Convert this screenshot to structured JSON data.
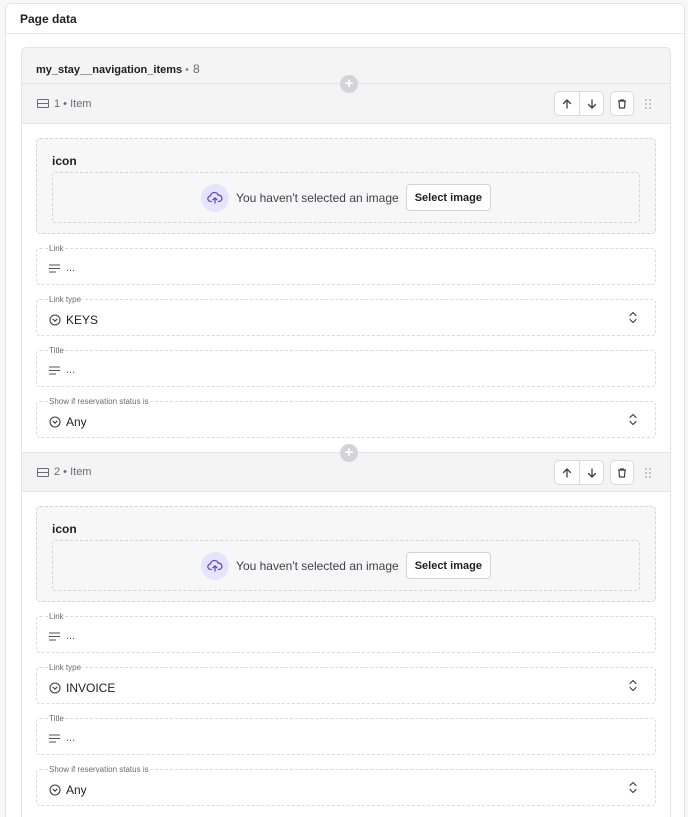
{
  "panel": {
    "title": "Page data"
  },
  "array": {
    "name": "my_stay__navigation_items",
    "separator": "•",
    "count": "8"
  },
  "items": [
    {
      "header_label": "1 • Item",
      "image_field": {
        "label": "icon",
        "empty_text": "You haven't selected an image",
        "select_label": "Select image"
      },
      "link": {
        "label": "Link",
        "value": "..."
      },
      "link_type": {
        "label": "Link type",
        "value": "KEYS"
      },
      "title": {
        "label": "Title",
        "value": "..."
      },
      "status": {
        "label": "Show if reservation status is",
        "value": "Any"
      }
    },
    {
      "header_label": "2 • Item",
      "image_field": {
        "label": "icon",
        "empty_text": "You haven't selected an image",
        "select_label": "Select image"
      },
      "link": {
        "label": "Link",
        "value": "..."
      },
      "link_type": {
        "label": "Link type",
        "value": "INVOICE"
      },
      "title": {
        "label": "Title",
        "value": "..."
      },
      "status": {
        "label": "Show if reservation status is",
        "value": "Any"
      }
    }
  ],
  "icons": {
    "row": "row-icon",
    "add": "plus-circle-icon",
    "move_up": "arrow-up-icon",
    "move_down": "arrow-down-icon",
    "delete": "trash-icon",
    "drag": "drag-handle-icon",
    "upload": "cloud-upload-icon",
    "text": "text-lines-icon",
    "select": "chevron-circle-icon",
    "sort": "chevrons-up-down-icon"
  },
  "colors": {
    "accent_soft": "#e6e4fb",
    "accent": "#5b4fc4",
    "border": "#e4e4e7",
    "header_bg": "#f4f4f5"
  }
}
